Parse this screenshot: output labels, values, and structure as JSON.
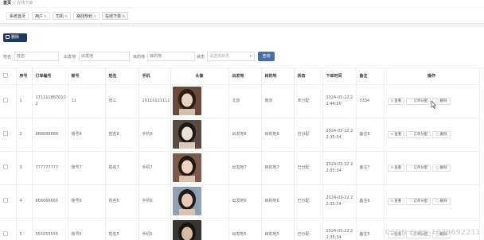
{
  "breadcrumb": {
    "home": "首页",
    "separator": "//",
    "current": "在线下单"
  },
  "tabs": [
    {
      "label": "系统首页",
      "closable": false
    },
    {
      "label": "用户",
      "closable": true
    },
    {
      "label": "司机",
      "closable": true
    },
    {
      "label": "路线规划",
      "closable": true
    },
    {
      "label": "在线下单",
      "closable": true,
      "active": true
    }
  ],
  "toolbar": {
    "delete_label": "删除"
  },
  "search": {
    "name_label": "姓名",
    "name_placeholder": "姓名",
    "from_label": "出发地",
    "from_placeholder": "出发地",
    "to_label": "目的地",
    "to_placeholder": "目的地",
    "status_label": "状态",
    "status_placeholder": "请选择状态",
    "query_label": "查询"
  },
  "table": {
    "columns": [
      "",
      "序号",
      "订单编号",
      "账号",
      "姓名",
      "手机",
      "头像",
      "出发地",
      "目的地",
      "状态",
      "下单时间",
      "备注",
      "操作"
    ],
    "rows": [
      {
        "index": "1",
        "order_no": "1711118670102",
        "account": "11",
        "name": "张三",
        "phone": "15111111111",
        "from": "北京",
        "to": "南京",
        "status": "未分配",
        "time": "2024-03-22 22:44:30",
        "note": "3334",
        "op_view": "查看",
        "op_assign": "订单分配",
        "op_delete": "删除"
      },
      {
        "index": "2",
        "order_no": "888888888",
        "account": "账号8",
        "name": "姓名8",
        "phone": "手机8",
        "from": "出发地8",
        "to": "目的地8",
        "status": "已分配",
        "time": "2024-03-22 22:35:34",
        "note": "备注8",
        "op_view": "查看",
        "op_assign": "订单分配",
        "op_delete": "删除"
      },
      {
        "index": "3",
        "order_no": "777777777",
        "account": "账号7",
        "name": "姓名7",
        "phone": "手机7",
        "from": "出发地7",
        "to": "目的地7",
        "status": "已分配",
        "time": "2024-03-22 22:35:34",
        "note": "备注7",
        "op_view": "查看",
        "op_assign": "订单分配",
        "op_delete": "删除"
      },
      {
        "index": "4",
        "order_no": "666666666",
        "account": "账号6",
        "name": "姓名6",
        "phone": "手机6",
        "from": "出发地6",
        "to": "目的地6",
        "status": "已分配",
        "time": "2024-03-22 22:35:34",
        "note": "备注6",
        "op_view": "查看",
        "op_assign": "订单分配",
        "op_delete": "删除"
      },
      {
        "index": "5",
        "order_no": "555555555",
        "account": "账号5",
        "name": "姓名5",
        "phone": "手机5",
        "from": "出发地5",
        "to": "目的地5",
        "status": "已分配",
        "time": "2024-03-22 22:35:34",
        "note": "备注5",
        "op_view": "查看",
        "op_assign": "订单分配",
        "op_delete": "删除"
      }
    ]
  },
  "icons": {
    "view": "view-icon",
    "assign": "heart-icon",
    "delete": "delete-icon",
    "close": "close-icon"
  },
  "colors": {
    "primary_dark": "#1e3a5f",
    "query_button": "#4a6fa5"
  },
  "watermark": "CSDN @qq_1039692211"
}
